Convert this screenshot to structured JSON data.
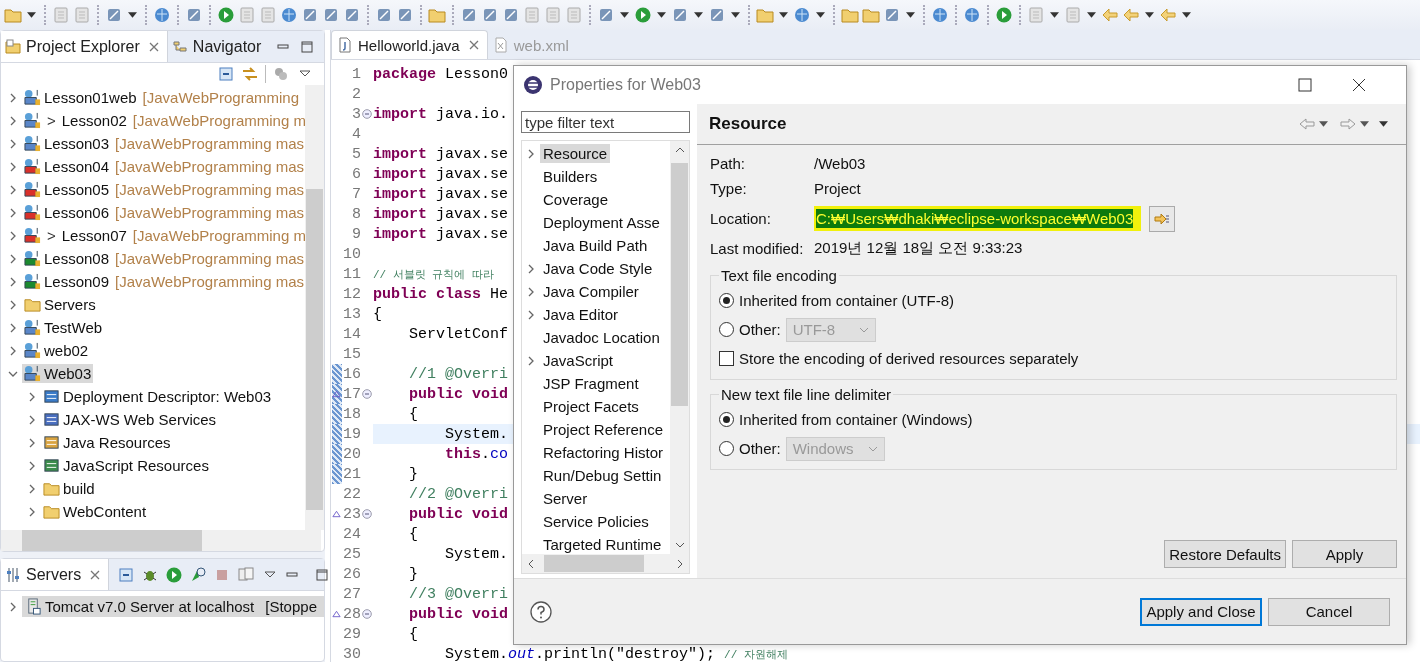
{
  "explorer": {
    "tabs": [
      {
        "label": "Project Explorer",
        "selected": true,
        "kind": "explorer"
      },
      {
        "label": "Navigator",
        "selected": false,
        "kind": "navigator"
      }
    ],
    "items": [
      {
        "name": "Lesson01web",
        "repo": "[JavaWebProgramming",
        "kind": "web",
        "expanded": false,
        "selected": false
      },
      {
        "name": "Lesson02",
        "prefix": ">",
        "repo": "[JavaWebProgramming m",
        "kind": "web",
        "expanded": false,
        "selected": false
      },
      {
        "name": "Lesson03",
        "repo": "[JavaWebProgramming mas",
        "kind": "web",
        "expanded": false,
        "selected": false
      },
      {
        "name": "Lesson04",
        "repo": "[JavaWebProgramming mas",
        "kind": "web-error",
        "expanded": false,
        "selected": false
      },
      {
        "name": "Lesson05",
        "repo": "[JavaWebProgramming mas",
        "kind": "web-error",
        "expanded": false,
        "selected": false
      },
      {
        "name": "Lesson06",
        "repo": "[JavaWebProgramming mas",
        "kind": "web-error",
        "expanded": false,
        "selected": false
      },
      {
        "name": "Lesson07",
        "prefix": ">",
        "repo": "[JavaWebProgramming m",
        "kind": "web-error",
        "expanded": false,
        "selected": false
      },
      {
        "name": "Lesson08",
        "repo": "[JavaWebProgramming mas",
        "kind": "gradle",
        "expanded": false,
        "selected": false
      },
      {
        "name": "Lesson09",
        "repo": "[JavaWebProgramming mas",
        "kind": "gradle",
        "expanded": false,
        "selected": false
      },
      {
        "name": "Servers",
        "kind": "folder",
        "expanded": false,
        "selected": false
      },
      {
        "name": "TestWeb",
        "kind": "web-plain",
        "expanded": false,
        "selected": false
      },
      {
        "name": "web02",
        "kind": "web-plain",
        "expanded": false,
        "selected": false
      },
      {
        "name": "Web03",
        "kind": "web-plain",
        "expanded": true,
        "selected": true,
        "children": [
          {
            "name": "Deployment Descriptor: Web03",
            "kind": "descriptor",
            "expanded": false,
            "selected": false
          },
          {
            "name": "JAX-WS Web Services",
            "kind": "webservice",
            "expanded": false,
            "selected": false
          },
          {
            "name": "Java Resources",
            "kind": "java-res",
            "expanded": false,
            "selected": false
          },
          {
            "name": "JavaScript Resources",
            "kind": "js-res",
            "expanded": false,
            "selected": false
          },
          {
            "name": "build",
            "kind": "folder",
            "expanded": false,
            "selected": false
          },
          {
            "name": "WebContent",
            "kind": "folder",
            "expanded": false,
            "selected": false
          }
        ]
      }
    ]
  },
  "servers": {
    "tab": "Servers",
    "rows": [
      {
        "label": "Tomcat v7.0 Server at localhost",
        "state": "[Stoppe",
        "selected": true
      }
    ]
  },
  "editor": {
    "tabs": [
      {
        "label": "Helloworld.java",
        "selected": true,
        "kind": "java"
      },
      {
        "label": "web.xml",
        "selected": false,
        "kind": "xml"
      }
    ],
    "lines": [
      {
        "num": "1",
        "fold": false,
        "override": false,
        "changed": false,
        "current": false,
        "tokens": [
          {
            "kind": "kw",
            "text": "package"
          },
          {
            "kind": "plain",
            "text": " Lesson0"
          }
        ]
      },
      {
        "num": "2",
        "fold": false,
        "override": false,
        "changed": false,
        "current": false
      },
      {
        "num": "3",
        "fold": true,
        "override": false,
        "changed": false,
        "current": false,
        "tokens": [
          {
            "kind": "kw",
            "text": "import"
          },
          {
            "kind": "plain",
            "text": " java.io."
          }
        ]
      },
      {
        "num": "4",
        "fold": false,
        "override": false,
        "changed": false,
        "current": false
      },
      {
        "num": "5",
        "fold": false,
        "override": false,
        "changed": false,
        "current": false,
        "tokens": [
          {
            "kind": "kw",
            "text": "import"
          },
          {
            "kind": "plain",
            "text": " javax.se"
          }
        ]
      },
      {
        "num": "6",
        "fold": false,
        "override": false,
        "changed": false,
        "current": false,
        "tokens": [
          {
            "kind": "kw",
            "text": "import"
          },
          {
            "kind": "plain",
            "text": " javax.se"
          }
        ]
      },
      {
        "num": "7",
        "fold": false,
        "override": false,
        "changed": false,
        "current": false,
        "tokens": [
          {
            "kind": "kw",
            "text": "import"
          },
          {
            "kind": "plain",
            "text": " javax.se"
          }
        ]
      },
      {
        "num": "8",
        "fold": false,
        "override": false,
        "changed": false,
        "current": false,
        "tokens": [
          {
            "kind": "kw",
            "text": "import"
          },
          {
            "kind": "plain",
            "text": " javax.se"
          }
        ]
      },
      {
        "num": "9",
        "fold": false,
        "override": false,
        "changed": false,
        "current": false,
        "tokens": [
          {
            "kind": "kw",
            "text": "import"
          },
          {
            "kind": "plain",
            "text": " javax.se"
          }
        ]
      },
      {
        "num": "10",
        "fold": false,
        "override": false,
        "changed": false,
        "current": false
      },
      {
        "num": "11",
        "fold": false,
        "override": false,
        "changed": false,
        "current": false,
        "tokens": [
          {
            "kind": "note",
            "text": "// 서블릿 규칙에 따라"
          }
        ]
      },
      {
        "num": "12",
        "fold": false,
        "override": false,
        "changed": false,
        "current": false,
        "tokens": [
          {
            "kind": "kw",
            "text": "public class"
          },
          {
            "kind": "plain",
            "text": " He"
          }
        ]
      },
      {
        "num": "13",
        "fold": false,
        "override": false,
        "changed": false,
        "current": false,
        "tokens": [
          {
            "kind": "plain",
            "text": "{"
          }
        ]
      },
      {
        "num": "14",
        "fold": false,
        "override": false,
        "changed": false,
        "current": false,
        "tokens": [
          {
            "kind": "plain",
            "text": "    ServletConf"
          }
        ]
      },
      {
        "num": "15",
        "fold": false,
        "override": false,
        "changed": false,
        "current": false
      },
      {
        "num": "16",
        "fold": false,
        "override": false,
        "changed": true,
        "current": false,
        "tokens": [
          {
            "kind": "comment",
            "text": "    //1 @Overri"
          }
        ]
      },
      {
        "num": "17",
        "fold": true,
        "override": true,
        "changed": true,
        "current": false,
        "tokens": [
          {
            "kind": "kw",
            "text": "    public void"
          }
        ]
      },
      {
        "num": "18",
        "fold": false,
        "override": false,
        "changed": true,
        "current": false,
        "tokens": [
          {
            "kind": "plain",
            "text": "    {"
          }
        ]
      },
      {
        "num": "19",
        "fold": false,
        "override": false,
        "changed": true,
        "current": true,
        "tokens": [
          {
            "kind": "plain",
            "text": "        System."
          }
        ]
      },
      {
        "num": "20",
        "fold": false,
        "override": false,
        "changed": true,
        "current": false,
        "tokens": [
          {
            "kind": "kw",
            "text": "        this"
          },
          {
            "kind": "plain",
            "text": "."
          },
          {
            "kind": "member",
            "text": "co"
          }
        ]
      },
      {
        "num": "21",
        "fold": false,
        "override": false,
        "changed": true,
        "current": false,
        "tokens": [
          {
            "kind": "plain",
            "text": "    }"
          }
        ]
      },
      {
        "num": "22",
        "fold": false,
        "override": false,
        "changed": false,
        "current": false,
        "tokens": [
          {
            "kind": "comment",
            "text": "    //2 @Overri"
          }
        ]
      },
      {
        "num": "23",
        "fold": true,
        "override": true,
        "changed": false,
        "current": false,
        "tokens": [
          {
            "kind": "kw",
            "text": "    public void"
          }
        ]
      },
      {
        "num": "24",
        "fold": false,
        "override": false,
        "changed": false,
        "current": false,
        "tokens": [
          {
            "kind": "plain",
            "text": "    {"
          }
        ]
      },
      {
        "num": "25",
        "fold": false,
        "override": false,
        "changed": false,
        "current": false,
        "tokens": [
          {
            "kind": "plain",
            "text": "        System."
          }
        ]
      },
      {
        "num": "26",
        "fold": false,
        "override": false,
        "changed": false,
        "current": false,
        "tokens": [
          {
            "kind": "plain",
            "text": "    }"
          }
        ]
      },
      {
        "num": "27",
        "fold": false,
        "override": false,
        "changed": false,
        "current": false,
        "tokens": [
          {
            "kind": "comment",
            "text": "    //3 @Overri"
          }
        ]
      },
      {
        "num": "28",
        "fold": true,
        "override": true,
        "changed": false,
        "current": false,
        "tokens": [
          {
            "kind": "kw",
            "text": "    public void"
          }
        ]
      },
      {
        "num": "29",
        "fold": false,
        "override": false,
        "changed": false,
        "current": false,
        "tokens": [
          {
            "kind": "plain",
            "text": "    {"
          }
        ]
      },
      {
        "num": "30",
        "fold": false,
        "override": false,
        "changed": false,
        "current": false,
        "tokens": [
          {
            "kind": "plain",
            "text": "        System."
          },
          {
            "kind": "field",
            "text": "out"
          },
          {
            "kind": "plain",
            "text": ".println(\"destroy\"); "
          },
          {
            "kind": "note",
            "text": "// 자원해제"
          }
        ]
      }
    ]
  },
  "dialog": {
    "title": "Properties for Web03",
    "filter": {
      "placeholder": "type filter text"
    },
    "pages": [
      {
        "label": "Resource",
        "expandable": true,
        "selected": true
      },
      {
        "label": "Builders",
        "expandable": false,
        "selected": false
      },
      {
        "label": "Coverage",
        "expandable": false,
        "selected": false
      },
      {
        "label": "Deployment Asse",
        "expandable": false,
        "selected": false
      },
      {
        "label": "Java Build Path",
        "expandable": false,
        "selected": false
      },
      {
        "label": "Java Code Style",
        "expandable": true,
        "selected": false
      },
      {
        "label": "Java Compiler",
        "expandable": true,
        "selected": false
      },
      {
        "label": "Java Editor",
        "expandable": true,
        "selected": false
      },
      {
        "label": "Javadoc Location",
        "expandable": false,
        "selected": false
      },
      {
        "label": "JavaScript",
        "expandable": true,
        "selected": false
      },
      {
        "label": "JSP Fragment",
        "expandable": false,
        "selected": false
      },
      {
        "label": "Project Facets",
        "expandable": false,
        "selected": false
      },
      {
        "label": "Project Reference",
        "expandable": false,
        "selected": false
      },
      {
        "label": "Refactoring Histor",
        "expandable": false,
        "selected": false
      },
      {
        "label": "Run/Debug Settin",
        "expandable": false,
        "selected": false
      },
      {
        "label": "Server",
        "expandable": false,
        "selected": false
      },
      {
        "label": "Service Policies",
        "expandable": false,
        "selected": false
      },
      {
        "label": "Targeted Runtime",
        "expandable": false,
        "selected": false
      }
    ],
    "page_title": "Resource",
    "info": [
      {
        "label": "Path:",
        "value": "/Web03",
        "kind": "text"
      },
      {
        "label": "Type:",
        "value": "Project",
        "kind": "text"
      },
      {
        "label": "Location:",
        "value": "C:₩Users₩dhaki₩eclipse-workspace₩Web03",
        "kind": "path"
      },
      {
        "label": "Last modified:",
        "value": "2019년 12월 18일 오전 9:33:23",
        "kind": "text"
      }
    ],
    "groups": [
      {
        "title": "Text file encoding",
        "options": [
          {
            "label": "Inherited from container (UTF-8)",
            "selected": true
          },
          {
            "label": "Other:",
            "selected": false,
            "combo": "UTF-8"
          }
        ],
        "checkbox": {
          "label": "Store the encoding of derived resources separately",
          "checked": false
        }
      },
      {
        "title": "New text file line delimiter",
        "options": [
          {
            "label": "Inherited from container (Windows)",
            "selected": true
          },
          {
            "label": "Other:",
            "selected": false,
            "combo": "Windows"
          }
        ]
      }
    ],
    "page_buttons": [
      {
        "label": "Restore Defaults",
        "default": false
      },
      {
        "label": "Apply",
        "default": false
      }
    ],
    "buttons": [
      {
        "label": "Apply and Close",
        "default": true
      },
      {
        "label": "Cancel",
        "default": false
      }
    ]
  }
}
